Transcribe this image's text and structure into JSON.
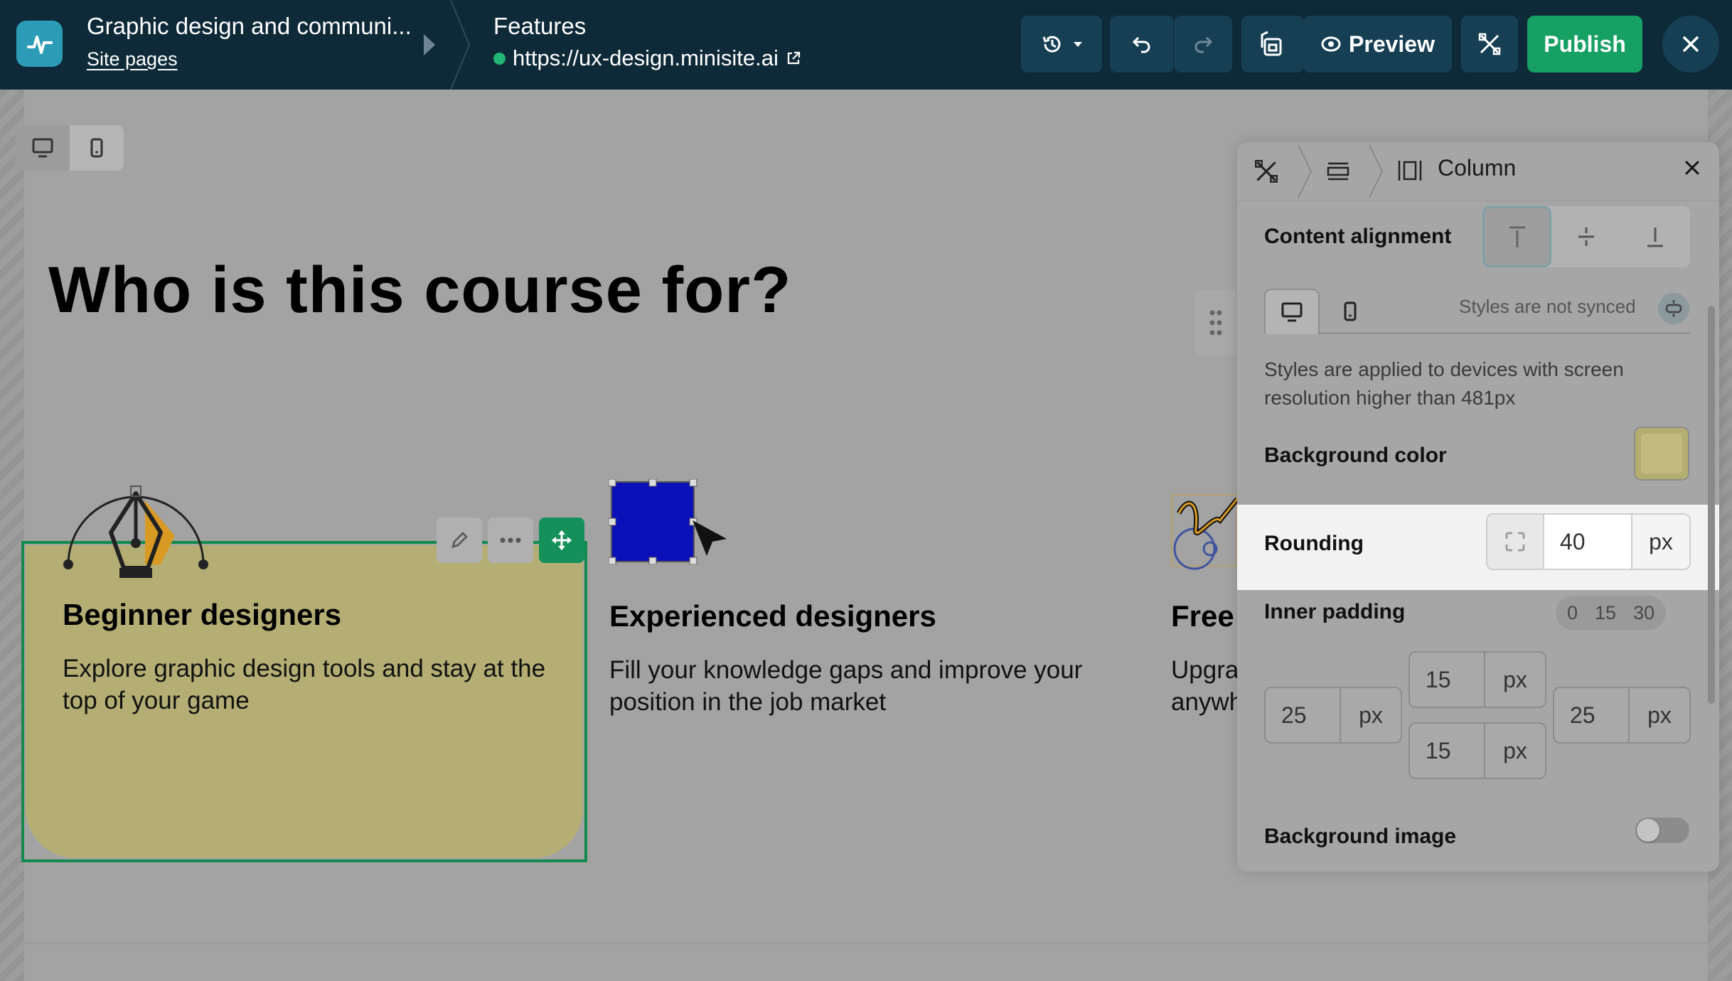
{
  "topbar": {
    "site_title": "Graphic design and communi...",
    "site_pages": "Site pages",
    "page_name": "Features",
    "page_url": "https://ux-design.minisite.ai",
    "preview_label": "Preview",
    "publish_label": "Publish"
  },
  "canvas": {
    "hero_title": "Who is this course for?",
    "cards": [
      {
        "title": "Beginner designers",
        "text": "Explore graphic design tools and stay at the top of your game"
      },
      {
        "title": "Experienced designers",
        "text": "Fill your knowledge gaps and improve your position in the job market"
      },
      {
        "title": "Free",
        "text_line1": "Upgra",
        "text_line2": "anywh"
      }
    ]
  },
  "panel": {
    "breadcrumb_current": "Column",
    "content_alignment_label": "Content alignment",
    "sync_status": "Styles are not synced",
    "device_note": "Styles are applied to devices with screen resolution higher than 481px",
    "background_color_label": "Background color",
    "background_color_value": "#c2bb80",
    "rounding_label": "Rounding",
    "rounding_value": "40",
    "rounding_unit": "px",
    "inner_padding_label": "Inner padding",
    "padding_presets": [
      "0",
      "15",
      "30"
    ],
    "padding": {
      "top": "15",
      "bottom": "15",
      "left": "25",
      "right": "25",
      "unit": "px"
    },
    "background_image_label": "Background image",
    "background_image_enabled": false
  },
  "colors": {
    "topbar": "#0e2a38",
    "publish": "#16a063",
    "selection": "#138a4f",
    "accent_teal": "#2b9bb6"
  }
}
